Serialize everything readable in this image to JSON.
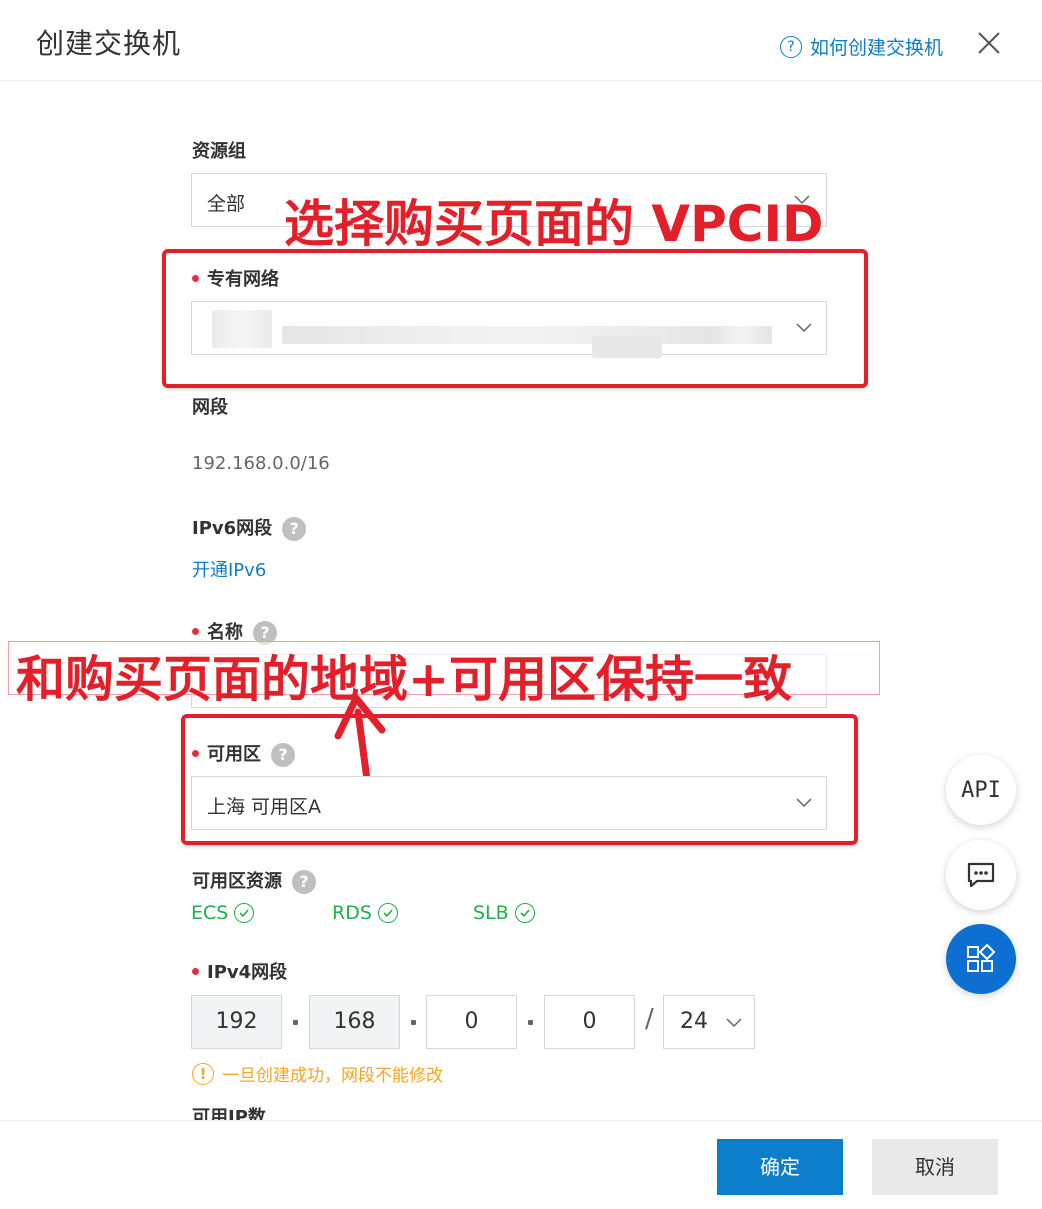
{
  "dialog": {
    "title": "创建交换机",
    "help_text": "如何创建交换机",
    "help_icon": "?"
  },
  "resource_group": {
    "label": "资源组",
    "value": "全部"
  },
  "vpc": {
    "label": "专有网络"
  },
  "cidr": {
    "label": "网段",
    "value": "192.168.0.0/16"
  },
  "ipv6": {
    "label": "IPv6网段",
    "link": "开通IPv6"
  },
  "name": {
    "label": "名称"
  },
  "zone": {
    "label": "可用区",
    "value": "上海 可用区A"
  },
  "zone_resources": {
    "label": "可用区资源",
    "items": [
      "ECS",
      "RDS",
      "SLB"
    ]
  },
  "ipv4": {
    "label": "IPv4网段",
    "octets": [
      "192",
      "168",
      "0",
      "0"
    ],
    "slash": "/",
    "mask": "24",
    "warning": "一旦创建成功，网段不能修改"
  },
  "available_ips": {
    "label": "可用IP数"
  },
  "footer": {
    "confirm": "确定",
    "cancel": "取消"
  },
  "side": {
    "api": "API"
  },
  "annotations": {
    "top": "选择购买页面的 VPCID",
    "middle": "和购买页面的地域+可用区保持一致"
  },
  "colors": {
    "primary": "#0d7ecb",
    "annotation": "#e3202a",
    "success": "#1bb34a",
    "warning": "#f5a623"
  }
}
